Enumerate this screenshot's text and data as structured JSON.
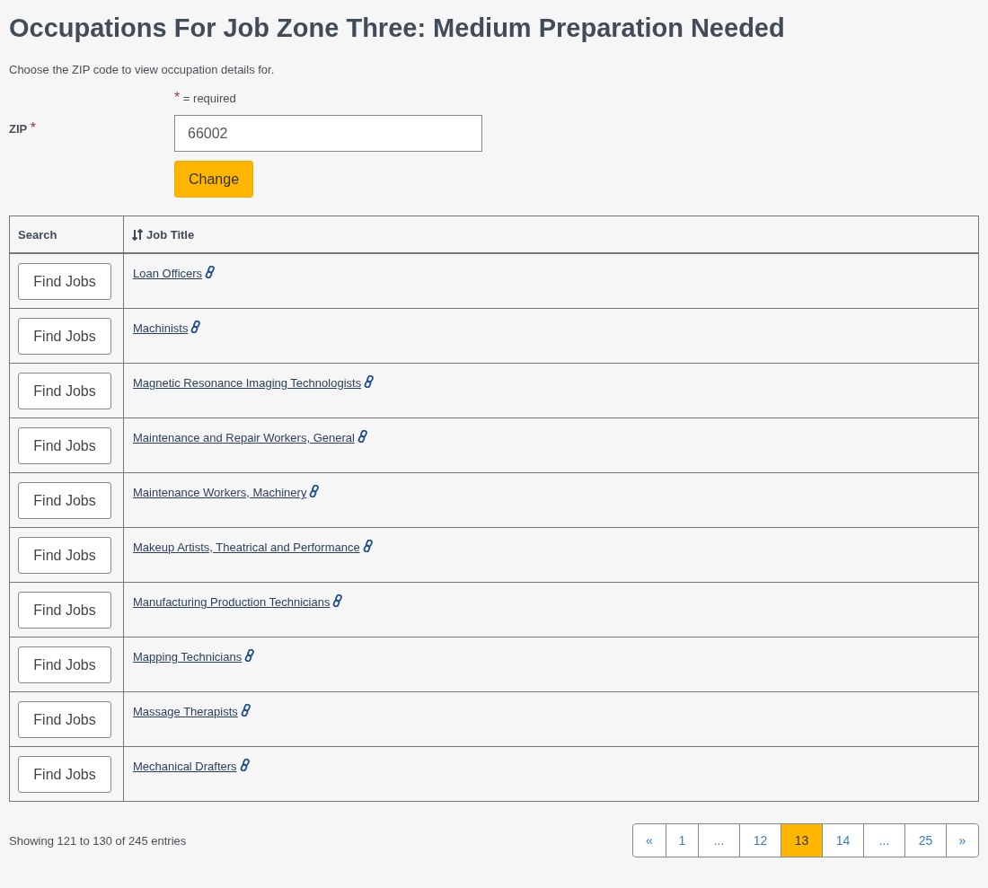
{
  "title": "Occupations For Job Zone Three: Medium Preparation Needed",
  "intro": "Choose the ZIP code to view occupation details for.",
  "required_note": {
    "mark": "*",
    "text": "= required"
  },
  "zip": {
    "label": "ZIP",
    "mark": "*",
    "value": "66002"
  },
  "change_button": "Change",
  "table": {
    "columns": [
      "Search",
      "Job Title"
    ],
    "rows": [
      {
        "button": "Find Jobs",
        "title": "Loan Officers"
      },
      {
        "button": "Find Jobs",
        "title": "Machinists"
      },
      {
        "button": "Find Jobs",
        "title": "Magnetic Resonance Imaging Technologists"
      },
      {
        "button": "Find Jobs",
        "title": "Maintenance and Repair Workers, General"
      },
      {
        "button": "Find Jobs",
        "title": "Maintenance Workers, Machinery"
      },
      {
        "button": "Find Jobs",
        "title": "Makeup Artists, Theatrical and Performance"
      },
      {
        "button": "Find Jobs",
        "title": "Manufacturing Production Technicians"
      },
      {
        "button": "Find Jobs",
        "title": "Mapping Technicians"
      },
      {
        "button": "Find Jobs",
        "title": "Massage Therapists"
      },
      {
        "button": "Find Jobs",
        "title": "Mechanical Drafters"
      }
    ]
  },
  "status": "Showing 121 to 130 of 245 entries",
  "pagination": [
    {
      "label": "«",
      "selected": false
    },
    {
      "label": "1",
      "selected": false
    },
    {
      "label": "...",
      "selected": false
    },
    {
      "label": "12",
      "selected": false
    },
    {
      "label": "13",
      "selected": true
    },
    {
      "label": "14",
      "selected": false
    },
    {
      "label": "...",
      "selected": false
    },
    {
      "label": "25",
      "selected": false
    },
    {
      "label": "»",
      "selected": false
    }
  ]
}
